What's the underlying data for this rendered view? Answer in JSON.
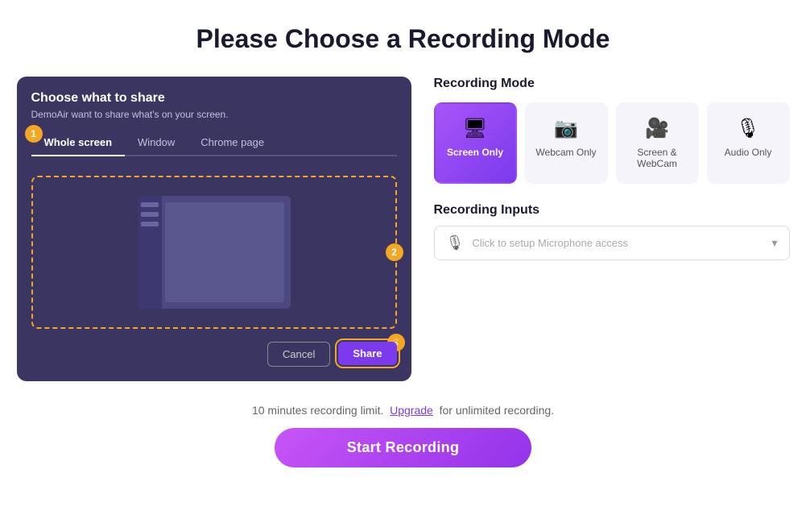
{
  "page": {
    "title": "Please Choose a Recording Mode"
  },
  "share_dialog": {
    "title": "Choose what to share",
    "subtitle": "DemoAir want to share what's on your screen.",
    "tabs": [
      {
        "label": "Whole screen",
        "active": true
      },
      {
        "label": "Window",
        "active": false
      },
      {
        "label": "Chrome page",
        "active": false
      }
    ],
    "cancel_label": "Cancel",
    "share_label": "Share",
    "step1": "1",
    "step2": "2",
    "step3": "3"
  },
  "recording_mode": {
    "section_label": "Recording Mode",
    "modes": [
      {
        "id": "screen-only",
        "label": "Screen Only",
        "icon": "🖥",
        "active": true
      },
      {
        "id": "webcam-only",
        "label": "Webcam Only",
        "icon": "📷",
        "active": false
      },
      {
        "id": "screen-webcam",
        "label": "Screen & WebCam",
        "icon": "🎥",
        "active": false
      },
      {
        "id": "audio-only",
        "label": "Audio Only",
        "icon": "🎙",
        "active": false
      }
    ]
  },
  "recording_inputs": {
    "section_label": "Recording Inputs",
    "mic_placeholder": "Click to setup Microphone access"
  },
  "footer": {
    "limit_text_before": "10 minutes recording limit.",
    "upgrade_label": "Upgrade",
    "limit_text_after": "for unlimited recording.",
    "start_button": "Start Recording"
  }
}
